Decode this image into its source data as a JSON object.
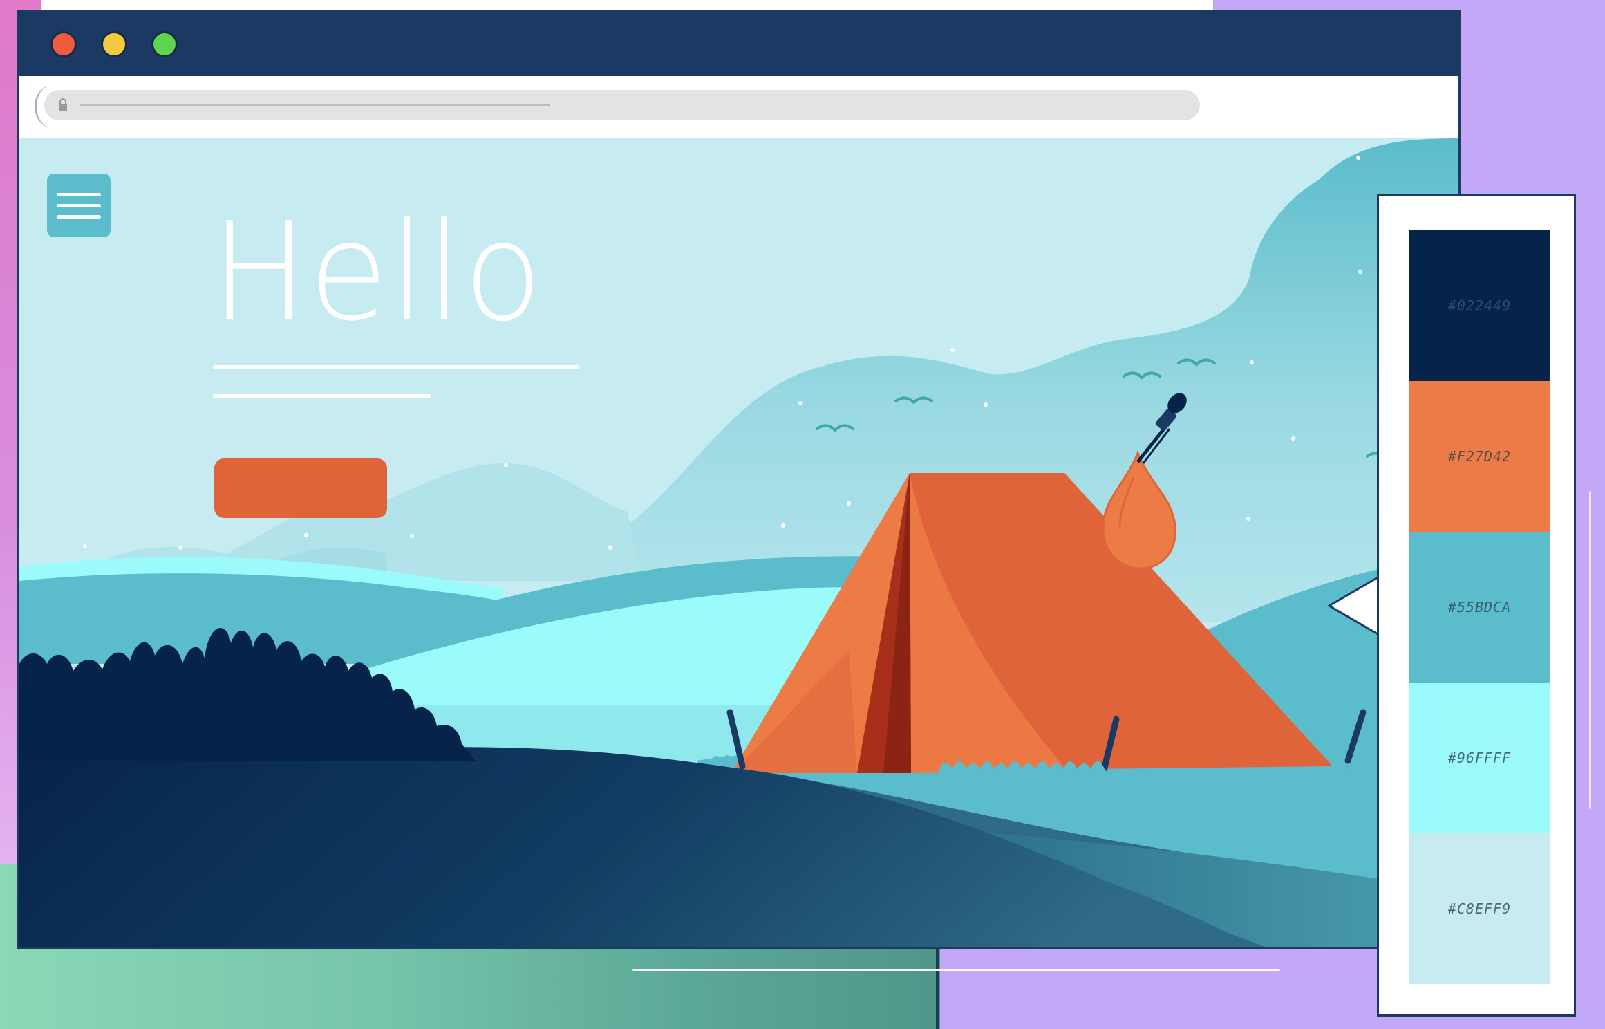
{
  "browser": {
    "window_buttons": [
      "close",
      "minimize",
      "maximize"
    ],
    "titlebar_color": "#1b3a63",
    "address_bar": {
      "url": "",
      "icon": "lock-icon"
    }
  },
  "page": {
    "heading": "Hello",
    "menu_icon": "hamburger-icon",
    "cta_button_label": "",
    "scene_icons": [
      "tent",
      "eyedropper-icon",
      "birds",
      "hills",
      "bushes"
    ]
  },
  "palette": {
    "colors": [
      {
        "label": "#022449",
        "hex": "#06234a"
      },
      {
        "label": "#F27D42",
        "hex": "#ed7b46"
      },
      {
        "label": "#55BDCA",
        "hex": "#5bbccb"
      },
      {
        "label": "#96FFFF",
        "hex": "#9bfbfb"
      },
      {
        "label": "#C8EFF9",
        "hex": "#c6ecf2"
      }
    ]
  }
}
